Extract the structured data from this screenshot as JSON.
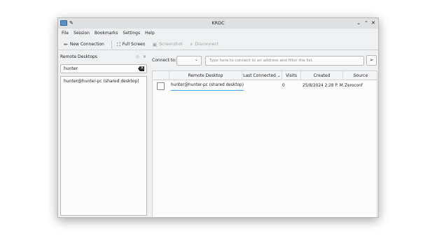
{
  "window": {
    "title": "KRDC"
  },
  "menu": [
    "File",
    "Session",
    "Bookmarks",
    "Settings",
    "Help"
  ],
  "toolbar": {
    "new_connection": "New Connection",
    "full_screen": "Full Screen",
    "screenshot": "Screenshot",
    "disconnect": "Disconnect"
  },
  "sidebar": {
    "title": "Remote Desktops",
    "search_value": "hunter",
    "items": [
      "hunter@hunter-pc (shared desktop)"
    ]
  },
  "connect": {
    "label": "Connect to:",
    "protocol": "",
    "placeholder": "Type here to connect to an address and filter the list."
  },
  "table": {
    "columns": [
      "Remote Desktop",
      "Last Connected",
      "Visits",
      "Created",
      "Source"
    ],
    "rows": [
      {
        "name": "hunter@hunter-pc (shared desktop)",
        "last_connected": "",
        "visits": "0",
        "created": "25/8/2024 2:28 P. M.",
        "source": "Zeroconf"
      }
    ]
  }
}
